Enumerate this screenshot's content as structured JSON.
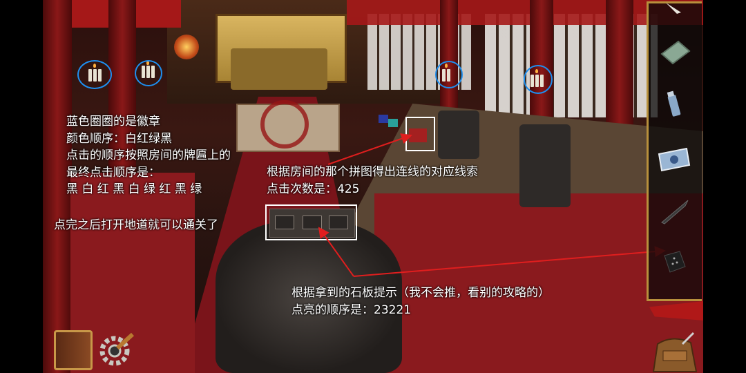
{
  "annotations": {
    "left_block": {
      "lines": [
        "蓝色圈圈的是徽章",
        "颜色顺序：白红绿黑",
        "点击的顺序按照房间的牌匾上的",
        "最终点击顺序是：",
        "黑 白 红 黑 白 绿 红 黑 绿"
      ]
    },
    "puzzle_hint": {
      "lines": [
        "根据房间的那个拼图得出连线的对应线索",
        "点击次数是：425"
      ]
    },
    "exit_hint": "点完之后打开地道就可以通关了",
    "stone_hint": {
      "lines": [
        "根据拿到的石板提示（我不会推，看别的攻略的）",
        "点亮的顺序是：23221"
      ]
    }
  },
  "colors": {
    "highlight_circle": "#1e8ff0",
    "highlight_rect": "#ffffff",
    "arrow": "#e01e1e",
    "carpet": "#8a1a1e",
    "pillar": "#7a1414",
    "gold": "#c8a14a"
  },
  "inventory": {
    "items": [
      {
        "icon": "knife-blade-icon"
      },
      {
        "icon": "green-book-icon"
      },
      {
        "icon": "lighter-icon"
      },
      {
        "icon": "paper-map-icon"
      },
      {
        "icon": "dagger-icon"
      },
      {
        "icon": "stone-tablet-icon"
      }
    ]
  },
  "hud": {
    "bottom_left": [
      "journal-book-icon",
      "settings-gear-icon"
    ],
    "bottom_right": "backpack-icon"
  }
}
